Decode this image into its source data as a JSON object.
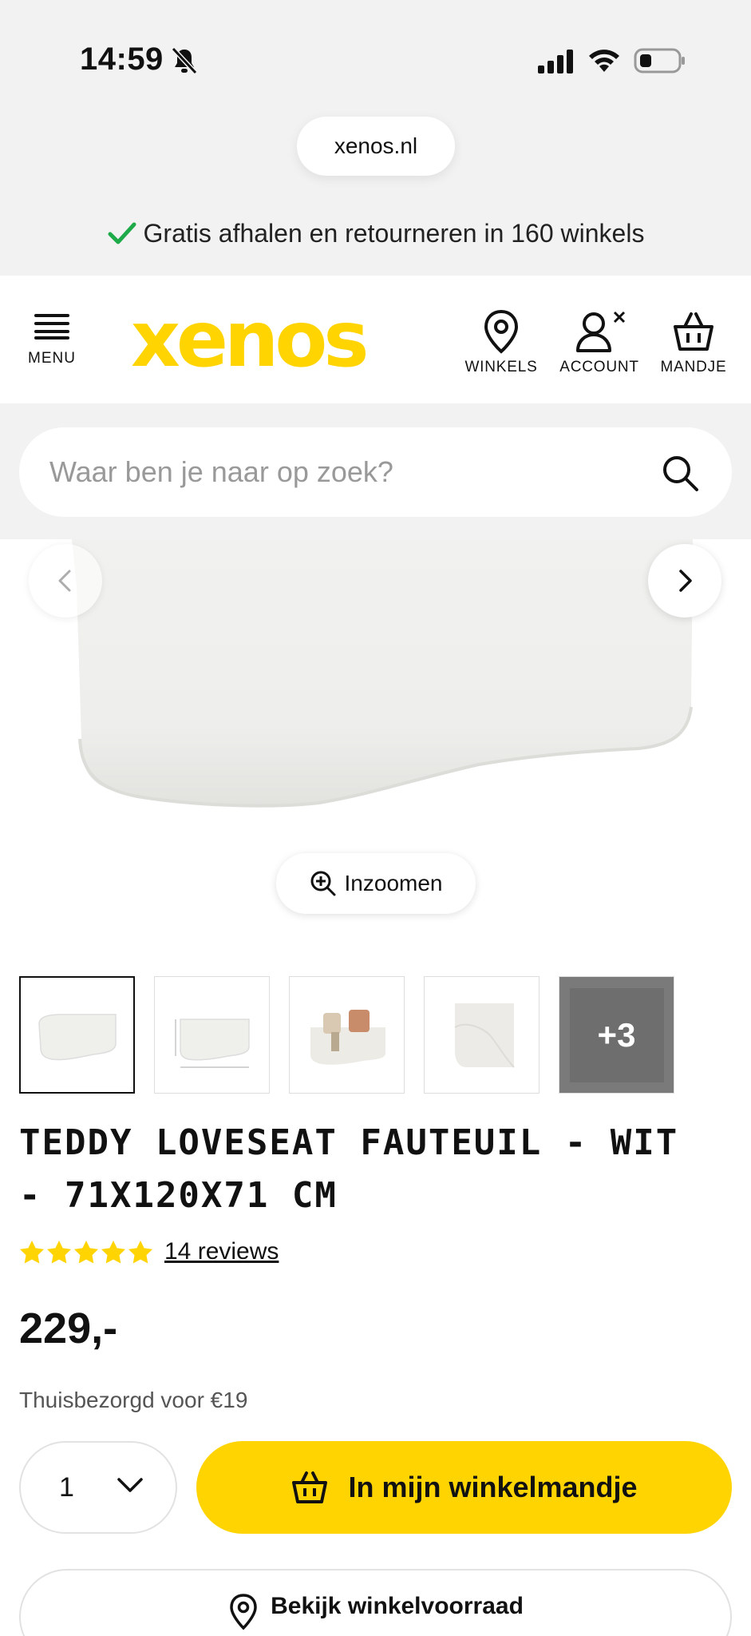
{
  "status_bar": {
    "time": "14:59"
  },
  "browser": {
    "url": "xenos.nl"
  },
  "promo": {
    "text": "Gratis afhalen en retourneren in 160 winkels"
  },
  "header": {
    "menu_label": "MENU",
    "logo": "xenos",
    "nav": {
      "stores": "WINKELS",
      "account": "ACCOUNT",
      "cart": "MANDJE"
    }
  },
  "search": {
    "placeholder": "Waar ben je naar op zoek?"
  },
  "gallery": {
    "zoom_label": "Inzoomen",
    "more_label": "+3"
  },
  "product": {
    "title": "TEDDY LOVESEAT FAUTEUIL - WIT - 71X120X71 CM",
    "rating": 5,
    "reviews": "14 reviews",
    "price": "229,-",
    "delivery": "Thuisbezorgd voor €19"
  },
  "purchase": {
    "quantity": "1",
    "add_to_cart": "In mijn winkelmandje",
    "store_stock": "Bekijk winkelvoorraad"
  },
  "colors": {
    "brand_yellow": "#ffd400",
    "check_green": "#1faa4a"
  }
}
